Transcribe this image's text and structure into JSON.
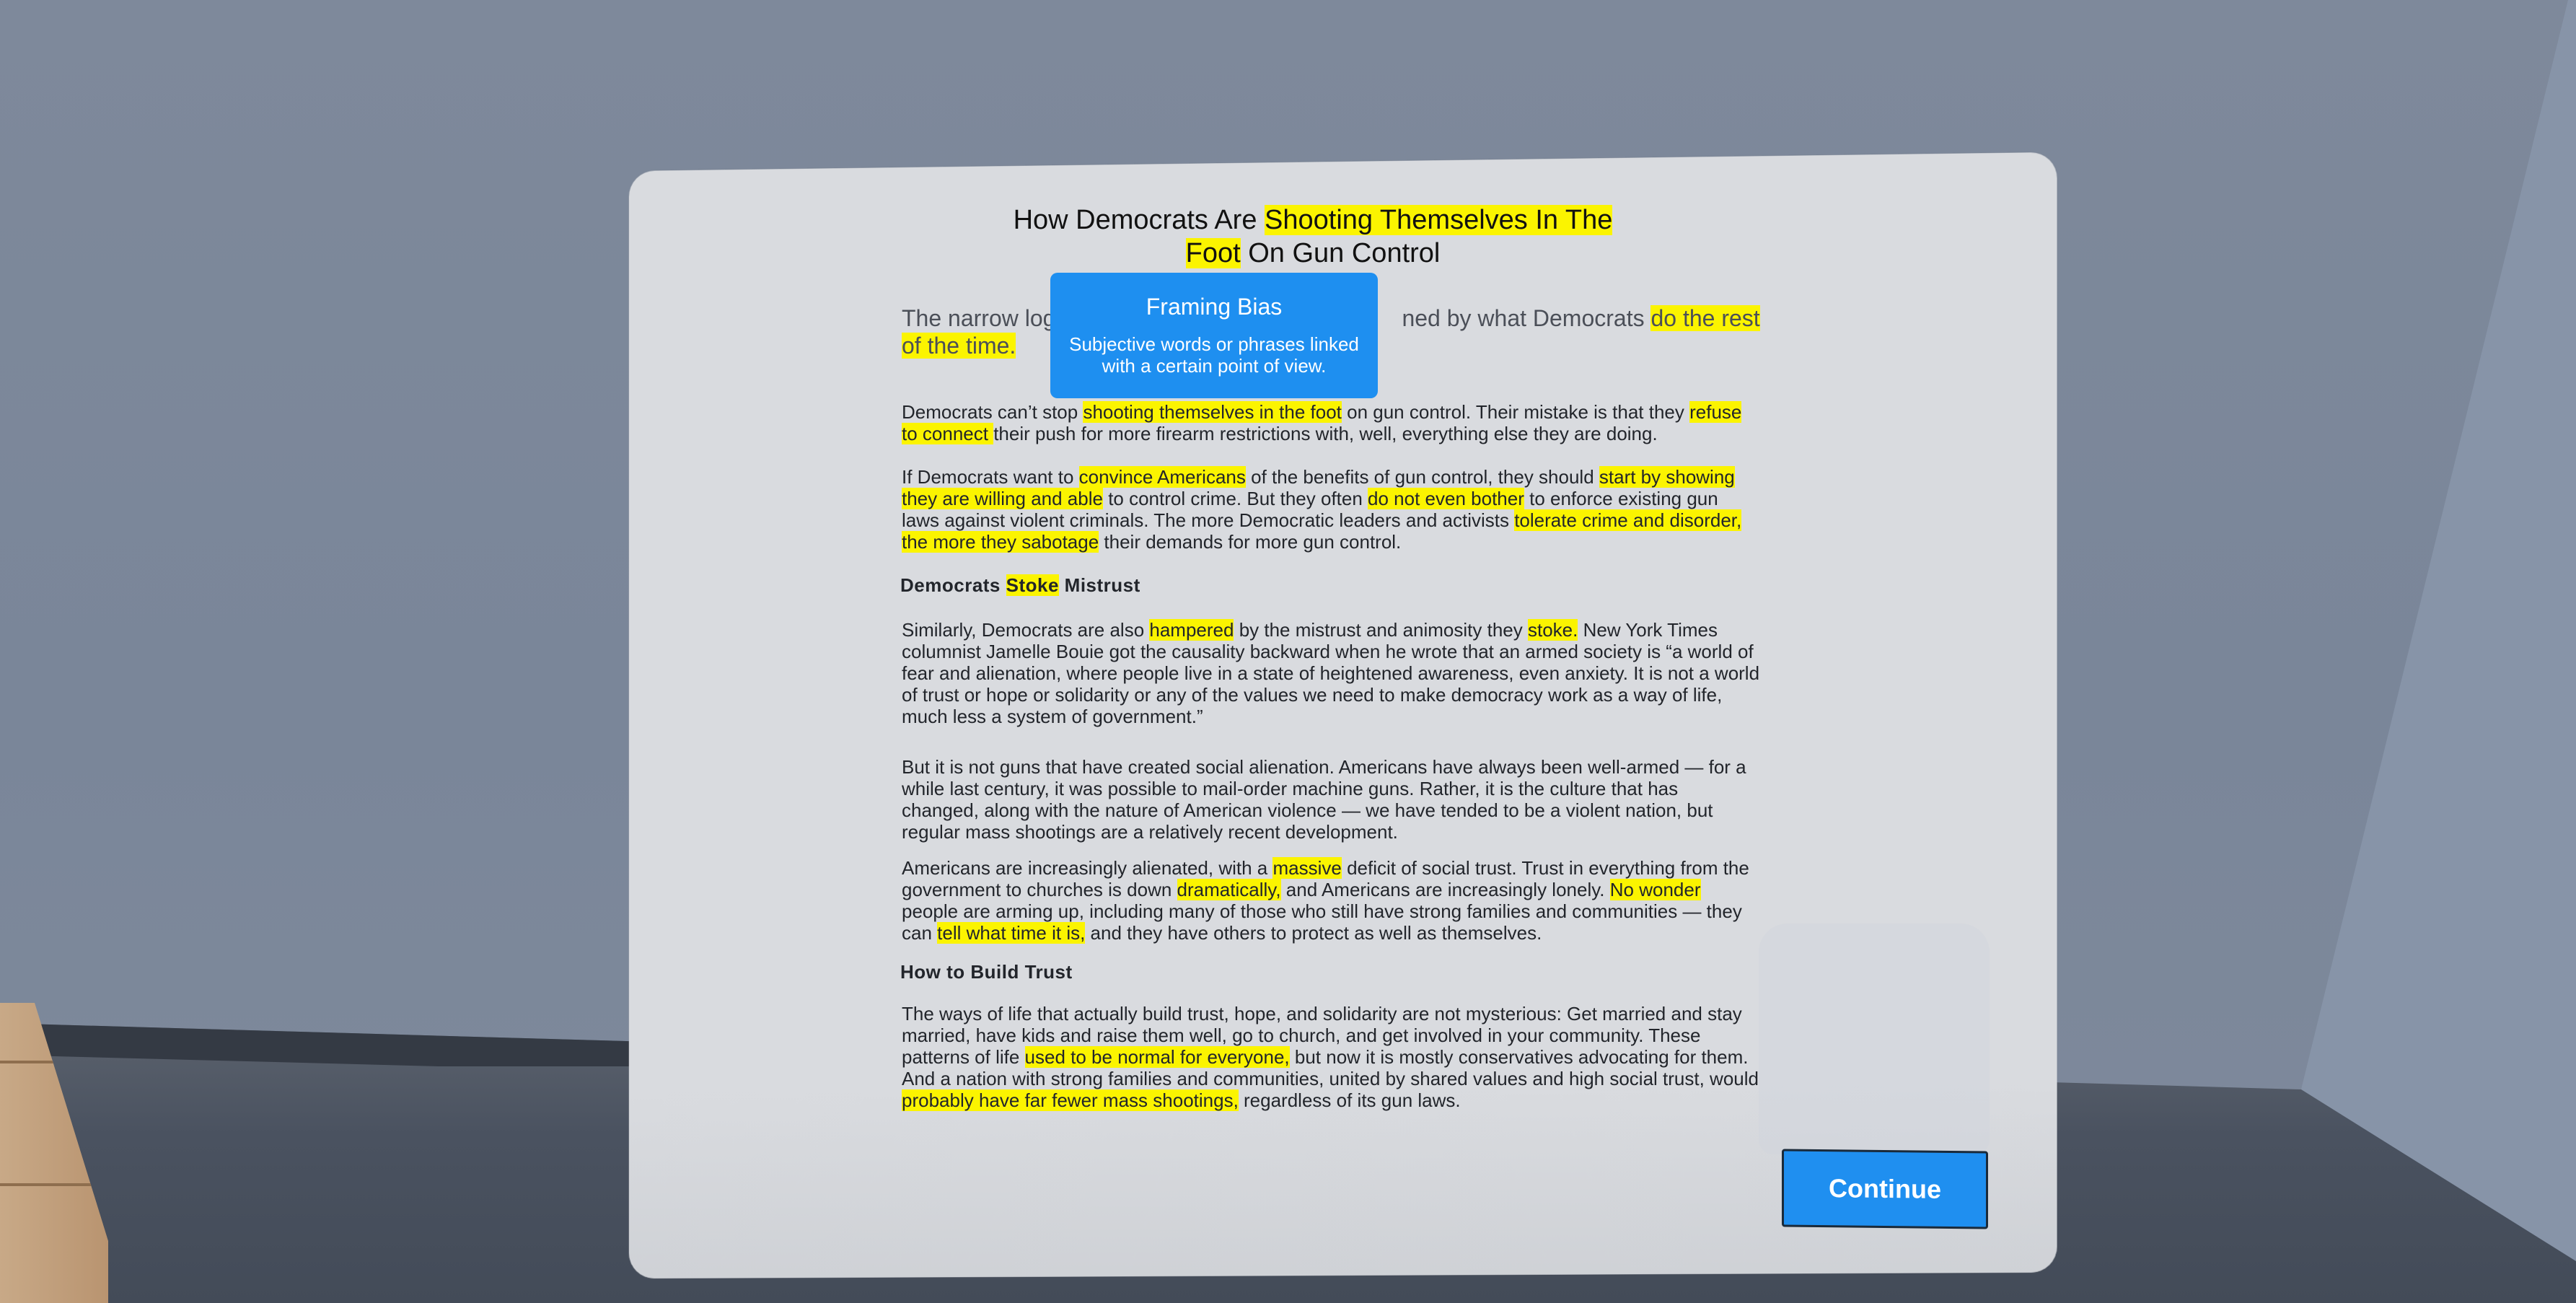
{
  "article": {
    "title": {
      "plain1": "How Democrats Are ",
      "hl1": "Shooting Themselves In The Foot",
      "plain2": " On Gun Control"
    },
    "lede": {
      "plain1": "The narrow log",
      "plain2": "ned by what Democrats ",
      "hl1": "do the rest of the time."
    },
    "p1": {
      "s1": "Democrats can’t stop ",
      "h1": "shooting themselves in the foot",
      "s2": " on gun control. Their mistake is that they ",
      "h2": "refuse to connect ",
      "s3": " their push for more firearm restrictions with, well, everything else they are doing."
    },
    "p2": {
      "s1": "If Democrats want to ",
      "h1": "convince Americans",
      "s2": " of the benefits of gun control, they should ",
      "h2": "start by showing they are willing and able",
      "s3": " to control crime. But they often ",
      "h3": "do not even bother",
      "s4": " to enforce existing gun laws against violent criminals. The more Democratic leaders and activists ",
      "h4": "tolerate crime and disorder, the more they sabotage",
      "s5": " their demands for more gun control."
    },
    "subhead1": {
      "s1": "Democrats ",
      "h1": "Stoke",
      "s2": " Mistrust"
    },
    "p3": {
      "s1": "Similarly, Democrats are also ",
      "h1": "hampered",
      "s2": " by the mistrust and animosity they ",
      "h2": "stoke.",
      "s3": " New York Times columnist Jamelle Bouie got the causality backward when he wrote that an armed society is “a world of fear and alienation, where people live in a state of heightened awareness, even anxiety. It is not a world of trust or hope or solidarity or any of the values we need to make democracy work as a way of life, much less a system of government.”"
    },
    "p4": "But it is not guns that have created social alienation. Americans have always been well-armed — for a while last century, it was possible to mail-order machine guns. Rather, it is the culture that has changed, along with the nature of American violence — we have tended to be a violent nation, but regular mass shootings are a relatively recent development.",
    "p5": {
      "s1": "Americans are increasingly alienated, with a ",
      "h1": "massive",
      "s2": " deficit of social trust. Trust in everything from the government to churches is down ",
      "h2": "dramatically,",
      "s3": " and Americans are increasingly lonely. ",
      "h3": "No wonder",
      "s4": " people are arming up, including many of those who still have strong families and communities — they can ",
      "h4": "tell what time it is,",
      "s5": " and they have others to protect as well as themselves."
    },
    "subhead2": "How to Build Trust",
    "p6": {
      "s1": "The ways of life that actually build trust, hope, and solidarity are not mysterious: Get married and stay married, have kids and raise them well, go to church, and get involved in your community. These patterns of life ",
      "h1": "used to be normal for everyone,",
      "s2": " but now it is mostly conservatives advocating for them. And a nation with strong families and communities, united by shared values and high social trust, would ",
      "h2": "probably have far fewer mass shootings,",
      "s3": " regardless of its gun laws."
    }
  },
  "tooltip": {
    "title": "Framing Bias",
    "description": "Subjective words or phrases linked with a certain point of view."
  },
  "continue_label": "Continue",
  "colors": {
    "highlight": "#fbf400",
    "accent": "#1f8ff0",
    "panel": "#d9dbdf"
  }
}
